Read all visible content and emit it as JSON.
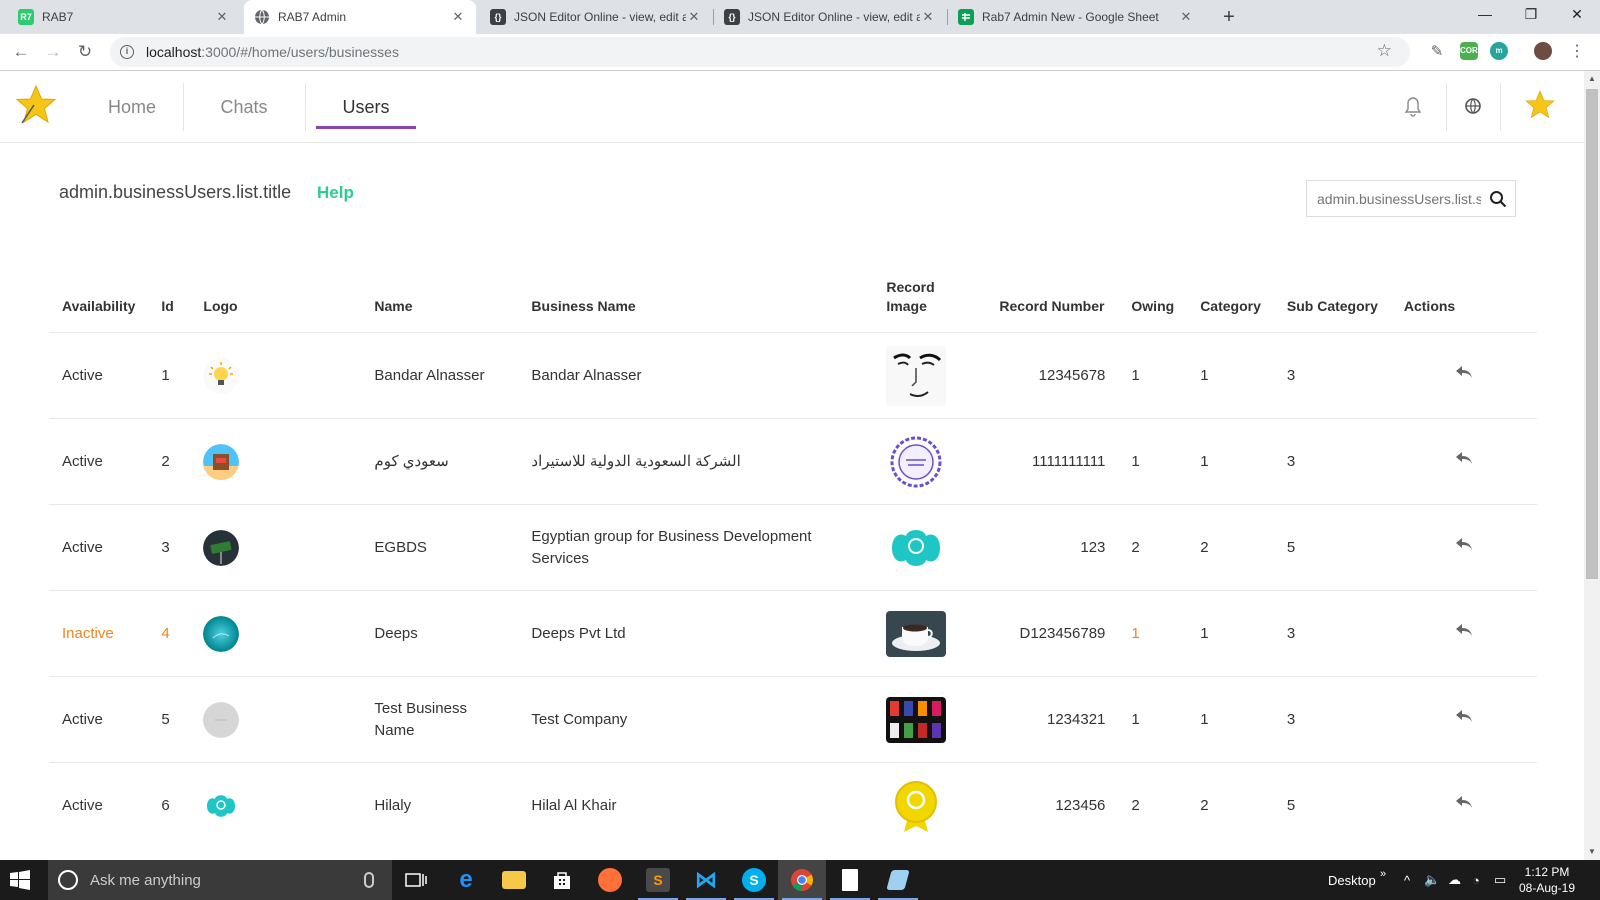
{
  "browser": {
    "tabs": [
      {
        "title": "RAB7",
        "favicon": "R7"
      },
      {
        "title": "RAB7 Admin",
        "favicon": "globe"
      },
      {
        "title": "JSON Editor Online - view, edit ar",
        "favicon": "{}"
      },
      {
        "title": "JSON Editor Online - view, edit ar",
        "favicon": "{}"
      },
      {
        "title": "Rab7 Admin New - Google Sheet",
        "favicon": "sheets"
      }
    ],
    "url_host": "localhost",
    "url_path": ":3000/#/home/users/businesses",
    "extensions": [
      {
        "label": "CORS",
        "color": "#4caf50"
      },
      {
        "label": "m",
        "color": "#26a69a"
      }
    ]
  },
  "app": {
    "nav": [
      {
        "label": "Home",
        "active": false
      },
      {
        "label": "Chats",
        "active": false
      },
      {
        "label": "Users",
        "active": true
      }
    ],
    "accent_color": "#8e44ad",
    "help_color": "#2ecc8f",
    "inactive_color": "#f0851b"
  },
  "page": {
    "title": "admin.businessUsers.list.title",
    "help_label": "Help",
    "search_placeholder": "admin.businessUsers.list.search"
  },
  "table": {
    "headers": {
      "availability": "Availability",
      "id": "Id",
      "logo": "Logo",
      "name": "Name",
      "business_name": "Business Name",
      "record_image": "Record Image",
      "record_number": "Record Number",
      "owing": "Owing",
      "category": "Category",
      "sub_category": "Sub Category",
      "actions": "Actions"
    },
    "rows": [
      {
        "availability": "Active",
        "id": "1",
        "name": "Bandar Alnasser",
        "business_name": "Bandar Alnasser",
        "record_number": "12345678",
        "owing": "1",
        "category": "1",
        "sub_category": "3",
        "logo_icon": "lightbulb-logo",
        "record_icon": "face-sketch",
        "inactive": false
      },
      {
        "availability": "Active",
        "id": "2",
        "name": "سعودي كوم",
        "business_name": "الشركة السعودية الدولية للاستيراد",
        "record_number": "1111111111",
        "owing": "1",
        "category": "1",
        "sub_category": "3",
        "logo_icon": "shop-logo",
        "record_icon": "purple-seal",
        "inactive": false
      },
      {
        "availability": "Active",
        "id": "3",
        "name": "EGBDS",
        "business_name": "Egyptian group for Business Development Services",
        "record_number": "123",
        "owing": "2",
        "category": "2",
        "sub_category": "5",
        "logo_icon": "street-sign-logo",
        "record_icon": "six-months-cloud",
        "inactive": false
      },
      {
        "availability": "Inactive",
        "id": "4",
        "name": "Deeps",
        "business_name": "Deeps Pvt Ltd",
        "record_number": "D123456789",
        "owing": "1",
        "category": "1",
        "sub_category": "3",
        "logo_icon": "ocean-logo",
        "record_icon": "coffee-cup",
        "inactive": true
      },
      {
        "availability": "Active",
        "id": "5",
        "name": "Test Business Name",
        "business_name": "Test Company",
        "record_number": "1234321",
        "owing": "1",
        "category": "1",
        "sub_category": "3",
        "logo_icon": "grey-logo",
        "record_icon": "color-grid",
        "inactive": false
      },
      {
        "availability": "Active",
        "id": "6",
        "name": "Hilaly",
        "business_name": "Hilal Al Khair",
        "record_number": "123456",
        "owing": "2",
        "category": "2",
        "sub_category": "5",
        "logo_icon": "six-months-logo",
        "record_icon": "gold-badge",
        "inactive": false
      }
    ]
  },
  "taskbar": {
    "search_placeholder": "Ask me anything",
    "desktop_label": "Desktop",
    "time": "1:12 PM",
    "date": "08-Aug-19"
  }
}
